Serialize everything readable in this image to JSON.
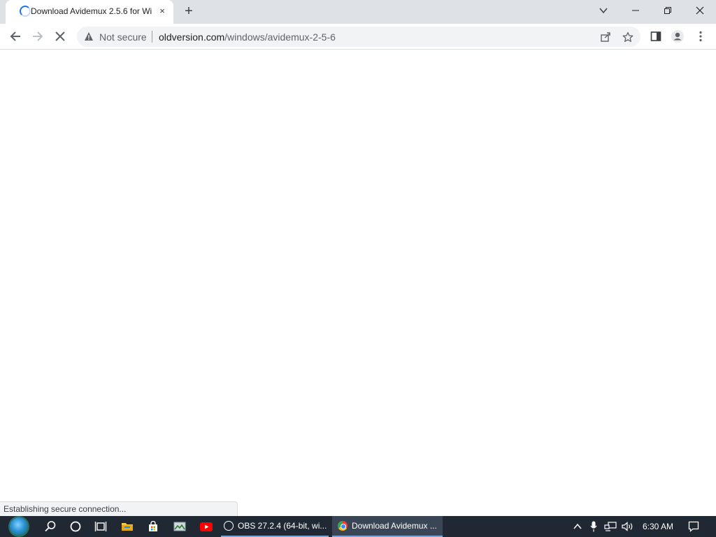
{
  "browser": {
    "tab": {
      "title": "Download Avidemux 2.5.6 for Wi",
      "close_label": "×"
    },
    "new_tab_label": "+",
    "omnibox": {
      "security_label": "Not secure",
      "url_domain": "oldversion.com",
      "url_path": "/windows/avidemux-2-5-6"
    },
    "status_text": "Establishing secure connection..."
  },
  "taskbar": {
    "apps": [
      {
        "label": "OBS 27.2.4 (64-bit, wi..."
      },
      {
        "label": "Download Avidemux ..."
      }
    ],
    "clock": "6:30 AM"
  },
  "icons": {
    "tab_spinner": "loading-spinner-icon",
    "back": "arrow-left-icon",
    "forward": "arrow-right-icon",
    "stop": "close-icon",
    "warning": "warning-triangle-icon",
    "share": "share-icon",
    "bookmark": "star-icon",
    "side_panel": "side-panel-icon",
    "profile": "person-icon",
    "menu": "kebab-menu-icon",
    "tab_search": "chevron-down-icon",
    "minimize": "minimize-icon",
    "restore": "restore-icon",
    "window_close": "close-icon"
  },
  "colors": {
    "accent": "#1a73e8",
    "tabstrip": "#dee1e6",
    "taskbar": "#1f2833"
  }
}
